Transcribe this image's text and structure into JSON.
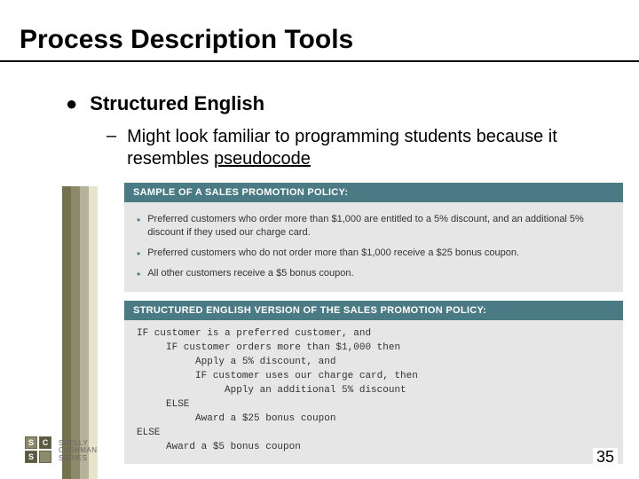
{
  "slide": {
    "title": "Process Description Tools",
    "page_number": "35",
    "bullet": {
      "marker": "●",
      "text": "Structured English"
    },
    "sub_bullet": {
      "marker": "–",
      "text_prefix": "Might look familiar to programming students because it resembles ",
      "underlined": "pseudocode"
    },
    "panel1": {
      "header": "SAMPLE OF A SALES PROMOTION POLICY:",
      "items": [
        "Preferred customers who order more than $1,000 are entitled to a 5% discount, and an additional 5% discount if they used our charge card.",
        "Preferred customers who do not order more than $1,000 receive a $25 bonus coupon.",
        "All other customers receive a $5 bonus coupon."
      ]
    },
    "panel2": {
      "header": "STRUCTURED ENGLISH VERSION OF THE SALES PROMOTION POLICY:",
      "code": [
        "IF customer is a preferred customer, and",
        "     IF customer orders more than $1,000 then",
        "          Apply a 5% discount, and",
        "          IF customer uses our charge card, then",
        "               Apply an additional 5% discount",
        "     ELSE",
        "          Award a $25 bonus coupon",
        "ELSE",
        "     Award a $5 bonus coupon"
      ]
    },
    "logo": {
      "brand_line1": "SHELLY",
      "brand_line2": "CASHMAN",
      "brand_line3": "SERIES"
    }
  }
}
